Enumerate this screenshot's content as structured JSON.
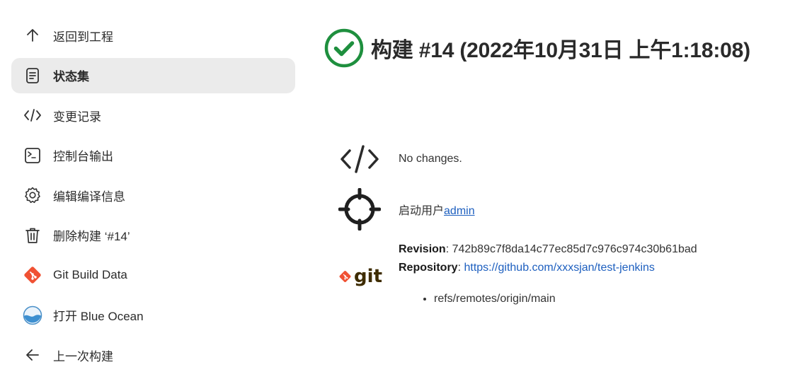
{
  "sidebar": {
    "items": [
      {
        "label": "返回到工程",
        "icon": "arrow-up-icon"
      },
      {
        "label": "状态集",
        "icon": "document-icon",
        "active": true
      },
      {
        "label": "变更记录",
        "icon": "code-icon"
      },
      {
        "label": "控制台输出",
        "icon": "terminal-icon"
      },
      {
        "label": "编辑编译信息",
        "icon": "gear-icon"
      },
      {
        "label": "删除构建 ‘#14’",
        "icon": "trash-icon"
      },
      {
        "label": "Git Build Data",
        "icon": "git-icon"
      },
      {
        "label": "打开 Blue Ocean",
        "icon": "blue-ocean-icon"
      },
      {
        "label": "上一次构建",
        "icon": "arrow-left-icon"
      }
    ]
  },
  "header": {
    "title": "构建 #14 (2022年10月31日 上午1:18:08)",
    "status_icon": "success-check-icon",
    "status_color": "#1e8f3e"
  },
  "changes": {
    "text": "No changes."
  },
  "started_by": {
    "prefix": "启动用户",
    "user": "admin"
  },
  "git": {
    "logo_text": "git",
    "revision_label": "Revision",
    "revision": "742b89c7f8da14c77ec85d7c976c974c30b61bad",
    "repository_label": "Repository",
    "repository": "https://github.com/xxxsjan/test-jenkins",
    "refs": [
      "refs/remotes/origin/main"
    ]
  },
  "colors": {
    "accent": "#1d5fbf",
    "git_orange": "#f05133",
    "active_bg": "#ebebeb"
  }
}
